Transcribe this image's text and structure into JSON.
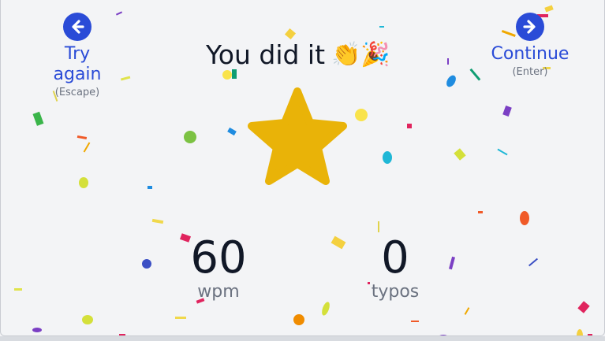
{
  "header": {
    "title": "You did it",
    "title_emoji": "👏🎉",
    "back": {
      "label": "Try again",
      "hint": "(Escape)",
      "icon": "arrow-left-icon"
    },
    "next": {
      "label": "Continue",
      "hint": "(Enter)",
      "icon": "arrow-right-icon"
    }
  },
  "result": {
    "star_icon": "star-icon",
    "wpm_value": "60",
    "wpm_label": "wpm",
    "typos_value": "0",
    "typos_label": "typos"
  },
  "colors": {
    "accent": "#2a4bd7",
    "star": "#e9b308",
    "background": "#f3f4f6"
  }
}
